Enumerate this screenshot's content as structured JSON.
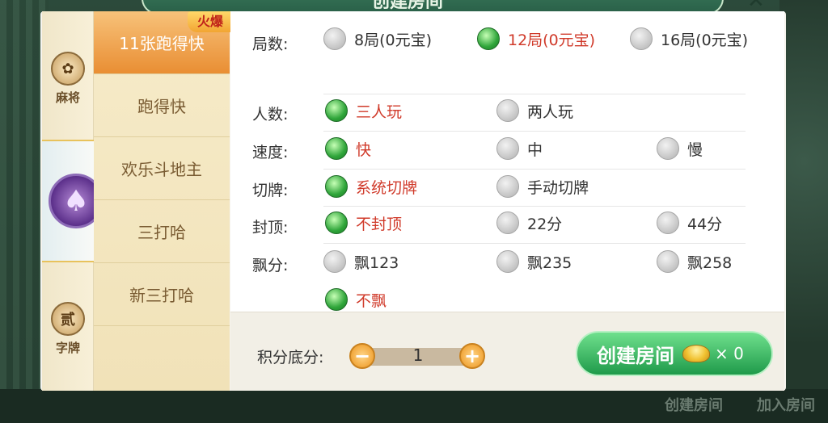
{
  "header": {
    "title": "创建房间",
    "close_label": "✕"
  },
  "categories": [
    {
      "name": "麻将",
      "icon": "mahjong-icon"
    },
    {
      "name": "",
      "icon": "spade-icon"
    },
    {
      "name": "字牌",
      "icon": "zipai-icon",
      "glyph": "贰"
    }
  ],
  "hot_badge": "火爆",
  "games": [
    "11张跑得快",
    "跑得快",
    "欢乐斗地主",
    "三打哈",
    "新三打哈"
  ],
  "settings": {
    "rounds": {
      "label": "局数:",
      "options": [
        "8局(0元宝)",
        "12局(0元宝)",
        "16局(0元宝)"
      ],
      "selected": 1
    },
    "players": {
      "label": "人数:",
      "options": [
        "三人玩",
        "两人玩"
      ],
      "selected": 0
    },
    "speed": {
      "label": "速度:",
      "options": [
        "快",
        "中",
        "慢"
      ],
      "selected": 0
    },
    "cut": {
      "label": "切牌:",
      "options": [
        "系统切牌",
        "手动切牌"
      ],
      "selected": 0
    },
    "cap": {
      "label": "封顶:",
      "options": [
        "不封顶",
        "22分",
        "44分"
      ],
      "selected": 0
    },
    "float": {
      "label": "飘分:",
      "options": [
        "飘123",
        "飘235",
        "飘258",
        "不飘"
      ],
      "selected": 3
    }
  },
  "footer": {
    "score_label": "积分底分:",
    "score_value": "1",
    "minus": "−",
    "plus": "+",
    "create_label": "创建房间",
    "cost": "× 0"
  },
  "bottom_bar": [
    "创建房间",
    "加入房间"
  ],
  "colors": {
    "accent_green": "#2fa53a",
    "selected_text": "#d03a2a",
    "hot_orange": "#e98e33"
  }
}
